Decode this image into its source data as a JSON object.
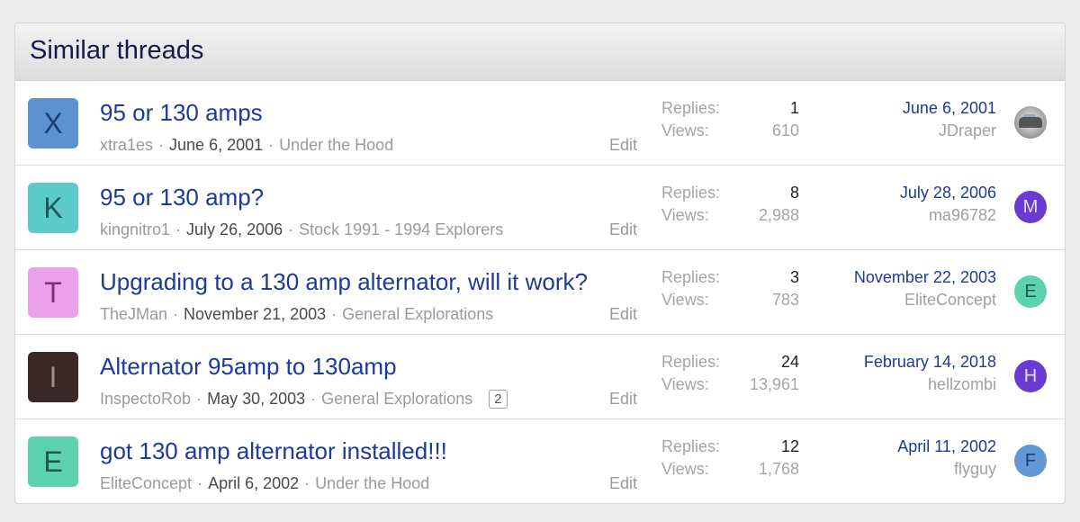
{
  "block": {
    "title": "Similar threads"
  },
  "labels": {
    "replies": "Replies:",
    "views": "Views:",
    "edit": "Edit",
    "sep": "·"
  },
  "threads": [
    {
      "avatar_letter": "X",
      "avatar_bg": "#5b92cf",
      "avatar_fg": "#1f3d70",
      "title": "95 or 130 amps",
      "author": "xtra1es",
      "date": "June 6, 2001",
      "forum": "Under the Hood",
      "replies": "1",
      "views": "610",
      "last_date": "June 6, 2001",
      "last_user": "JDraper",
      "last_avatar": "photo"
    },
    {
      "avatar_letter": "K",
      "avatar_bg": "#5ccac8",
      "avatar_fg": "#1c5958",
      "title": "95 or 130 amp?",
      "author": "kingnitro1",
      "date": "July 26, 2006",
      "forum": "Stock 1991 - 1994 Explorers",
      "replies": "8",
      "views": "2,988",
      "last_date": "July 28, 2006",
      "last_user": "ma96782",
      "last_avatar_letter": "M",
      "last_avatar_bg": "#6a3bd1",
      "last_avatar_fg": "#e6dcff"
    },
    {
      "avatar_letter": "T",
      "avatar_bg": "#eaa0ea",
      "avatar_fg": "#7d2d80",
      "title": "Upgrading to a 130 amp alternator, will it work?",
      "author": "TheJMan",
      "date": "November 21, 2003",
      "forum": "General Explorations",
      "replies": "3",
      "views": "783",
      "last_date": "November 22, 2003",
      "last_user": "EliteConcept",
      "last_avatar_letter": "E",
      "last_avatar_bg": "#5dd2ae",
      "last_avatar_fg": "#1d5b48"
    },
    {
      "avatar_letter": "I",
      "avatar_bg": "#3a2728",
      "avatar_fg": "#a98c8c",
      "title": "Alternator 95amp to 130amp",
      "author": "InspectoRob",
      "date": "May 30, 2003",
      "forum": "General Explorations",
      "page_badge": "2",
      "replies": "24",
      "views": "13,961",
      "last_date": "February 14, 2018",
      "last_user": "hellzombi",
      "last_avatar_letter": "H",
      "last_avatar_bg": "#6a3bd1",
      "last_avatar_fg": "#e6dcff"
    },
    {
      "avatar_letter": "E",
      "avatar_bg": "#5dd2ae",
      "avatar_fg": "#1d5b48",
      "title": "got 130 amp alternator installed!!!",
      "author": "EliteConcept",
      "date": "April 6, 2002",
      "forum": "Under the Hood",
      "replies": "12",
      "views": "1,768",
      "last_date": "April 11, 2002",
      "last_user": "flyguy",
      "last_avatar_letter": "F",
      "last_avatar_bg": "#6497d6",
      "last_avatar_fg": "#203f6e"
    }
  ]
}
